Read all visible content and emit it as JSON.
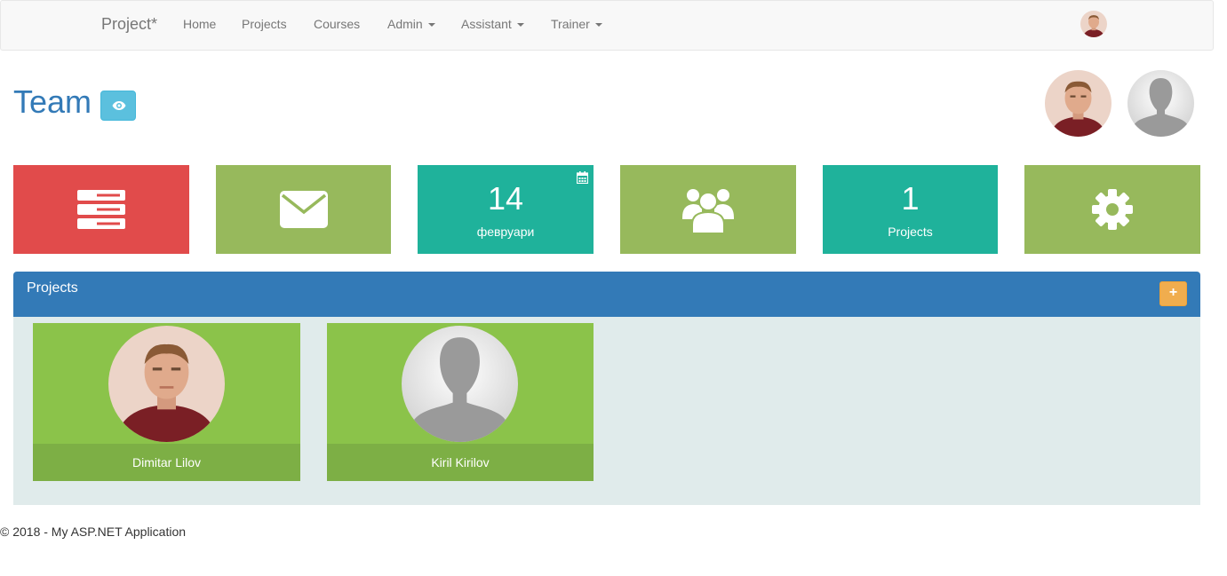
{
  "navbar": {
    "brand": "Project*",
    "items": [
      {
        "label": "Home"
      },
      {
        "label": "Projects"
      },
      {
        "label": "Courses"
      },
      {
        "label": "Admin",
        "dropdown": true
      },
      {
        "label": "Assistant",
        "dropdown": true
      },
      {
        "label": "Trainer",
        "dropdown": true
      }
    ],
    "user_avatar": "user-photo"
  },
  "header": {
    "title": "Team",
    "view_icon": "eye-icon",
    "avatars": [
      "user-photo",
      "default-silhouette"
    ]
  },
  "tiles": [
    {
      "color": "#e14b4b",
      "icon": "server-list-icon"
    },
    {
      "color": "#97b95c",
      "icon": "envelope-icon"
    },
    {
      "color": "#1fb29b",
      "big": "14",
      "small": "февруари",
      "corner_icon": "calendar-icon"
    },
    {
      "color": "#97b95c",
      "icon": "users-icon"
    },
    {
      "color": "#1fb29b",
      "big": "1",
      "small": "Projects"
    },
    {
      "color": "#97b95c",
      "icon": "gear-icon"
    }
  ],
  "panel": {
    "title": "Projects",
    "add_label": "+",
    "members": [
      {
        "name": "Dimitar Lilov",
        "avatar": "user-photo"
      },
      {
        "name": "Kiril Kirilov",
        "avatar": "default-silhouette"
      }
    ]
  },
  "footer": {
    "text": "© 2018 - My ASP.NET Application"
  },
  "colors": {
    "primary": "#337ab7",
    "info": "#5bc0de",
    "warning": "#f0ad4e",
    "card": "#8bc34a"
  }
}
